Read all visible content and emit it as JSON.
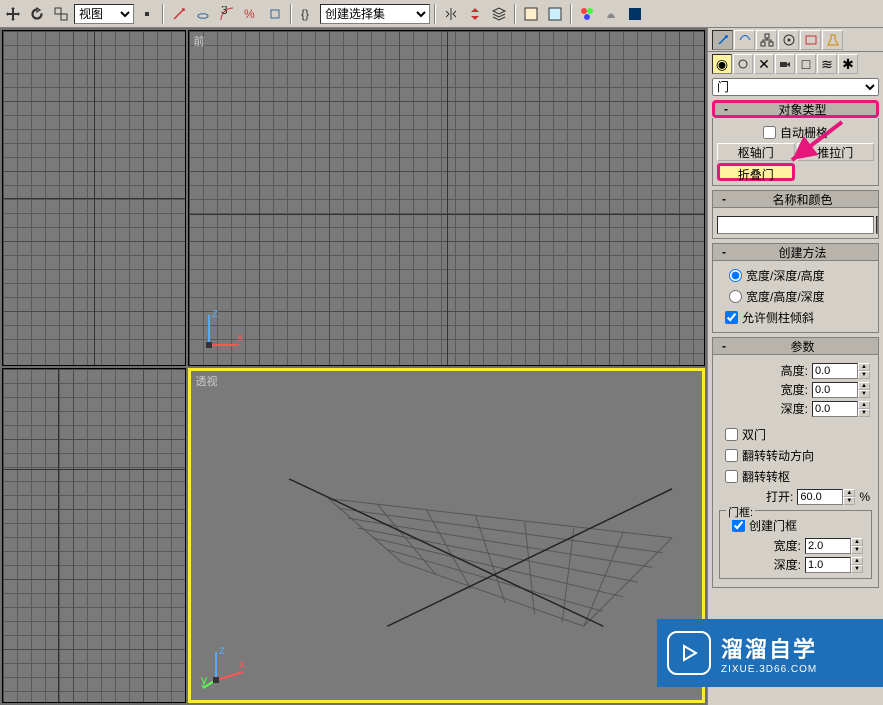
{
  "toolbar": {
    "view_select": "视图",
    "named_sets": "创建选择集"
  },
  "viewports": {
    "front_label": "前",
    "perspective_label": "透视"
  },
  "command_panel": {
    "category_select": "门",
    "rollouts": {
      "object_type": {
        "title": "对象类型",
        "auto_grid": "自动栅格",
        "buttons": {
          "pivot_door": "枢轴门",
          "sliding_door": "推拉门",
          "bifold_door": "折叠门"
        }
      },
      "name_color": {
        "title": "名称和颜色"
      },
      "create_method": {
        "title": "创建方法",
        "opt_wdh": "宽度/深度/高度",
        "opt_whd": "宽度/高度/深度",
        "allow_tilt": "允许侧柱倾斜"
      },
      "parameters": {
        "title": "参数",
        "height_label": "高度:",
        "height_val": "0.0",
        "width_label": "宽度:",
        "width_val": "0.0",
        "depth_label": "深度:",
        "depth_val": "0.0",
        "double_doors": "双门",
        "flip_swing": "翻转转动方向",
        "flip_hinge": "翻转转枢",
        "open_label": "打开:",
        "open_val": "60.0",
        "open_unit": "%",
        "frame_group": "门框:",
        "create_frame": "创建门框",
        "frame_width_label": "宽度:",
        "frame_width_val": "2.0",
        "frame_depth_label": "深度:",
        "frame_depth_val": "1.0"
      }
    }
  },
  "watermark": {
    "title": "溜溜自学",
    "url": "ZIXUE.3D66.COM"
  }
}
